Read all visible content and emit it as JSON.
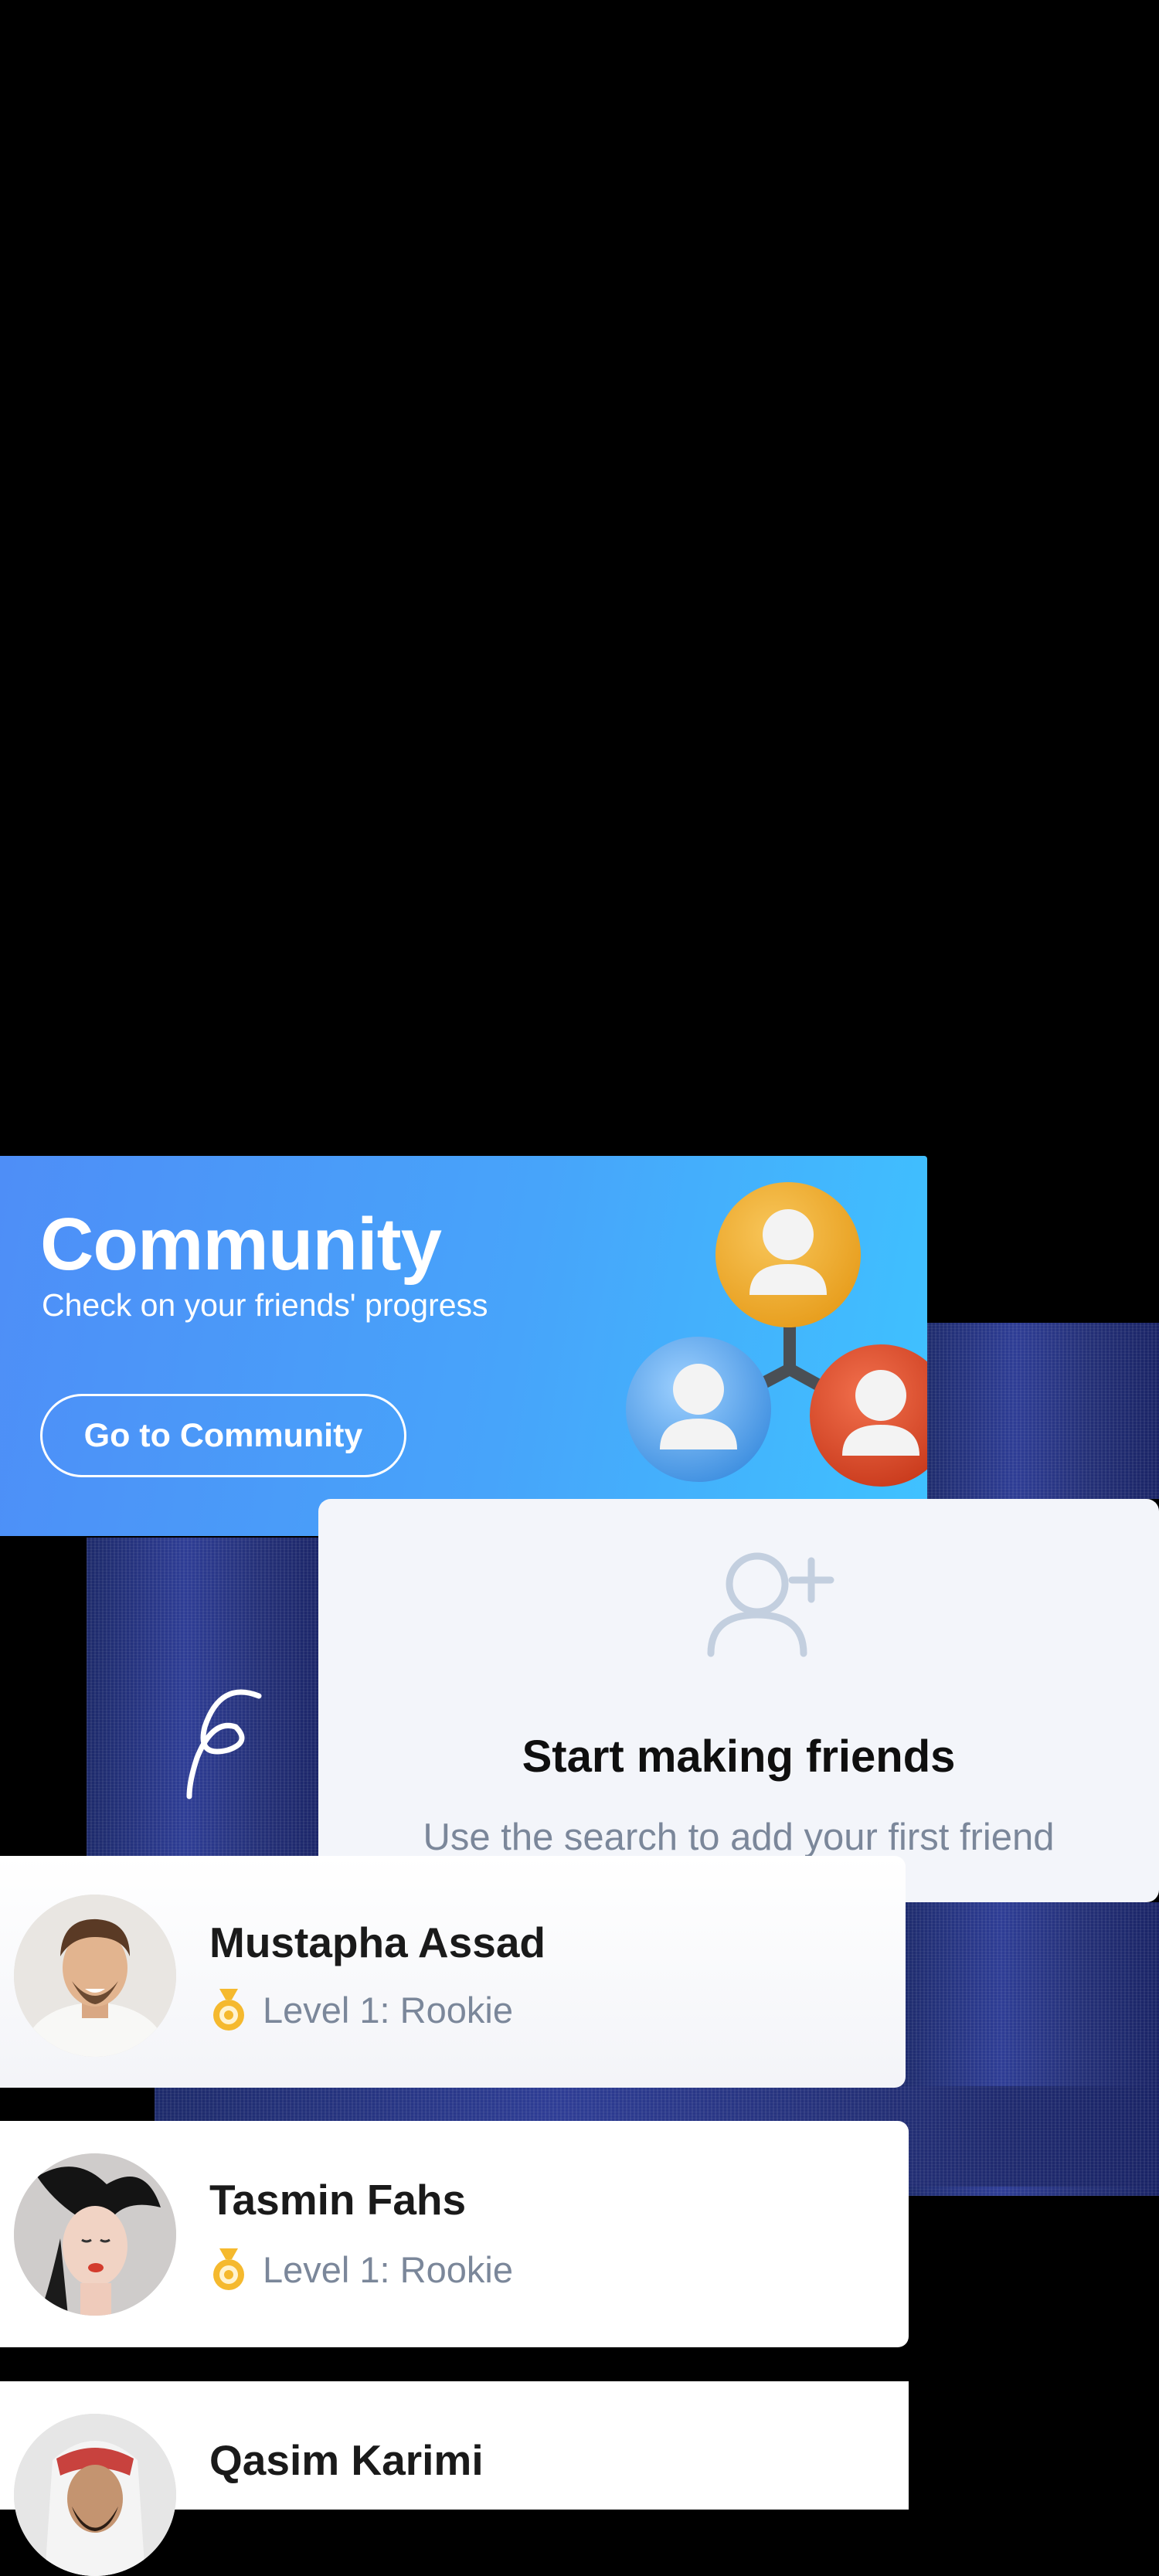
{
  "community": {
    "title": "Community",
    "subtitle": "Check on your friends' progress",
    "button_label": "Go to Community",
    "illustration_icon": "people-network-icon"
  },
  "friends_empty": {
    "icon": "add-user-icon",
    "title": "Start making friends",
    "subtitle": "Use the search to add your first friend"
  },
  "users": [
    {
      "name": "Mustapha Assad",
      "level": "Level 1: Rookie",
      "avatar_icon": "avatar-mustapha"
    },
    {
      "name": "Tasmin Fahs",
      "level": "Level 1: Rookie",
      "avatar_icon": "avatar-tasmin"
    },
    {
      "name": "Qasim Karimi",
      "level": "",
      "avatar_icon": "avatar-qasim"
    }
  ],
  "colors": {
    "banner_start": "#4e8ef7",
    "banner_end": "#3fc2ff",
    "card_bg": "#f3f5fa",
    "muted_text": "#7b879a",
    "medal": "#f5b92e"
  }
}
